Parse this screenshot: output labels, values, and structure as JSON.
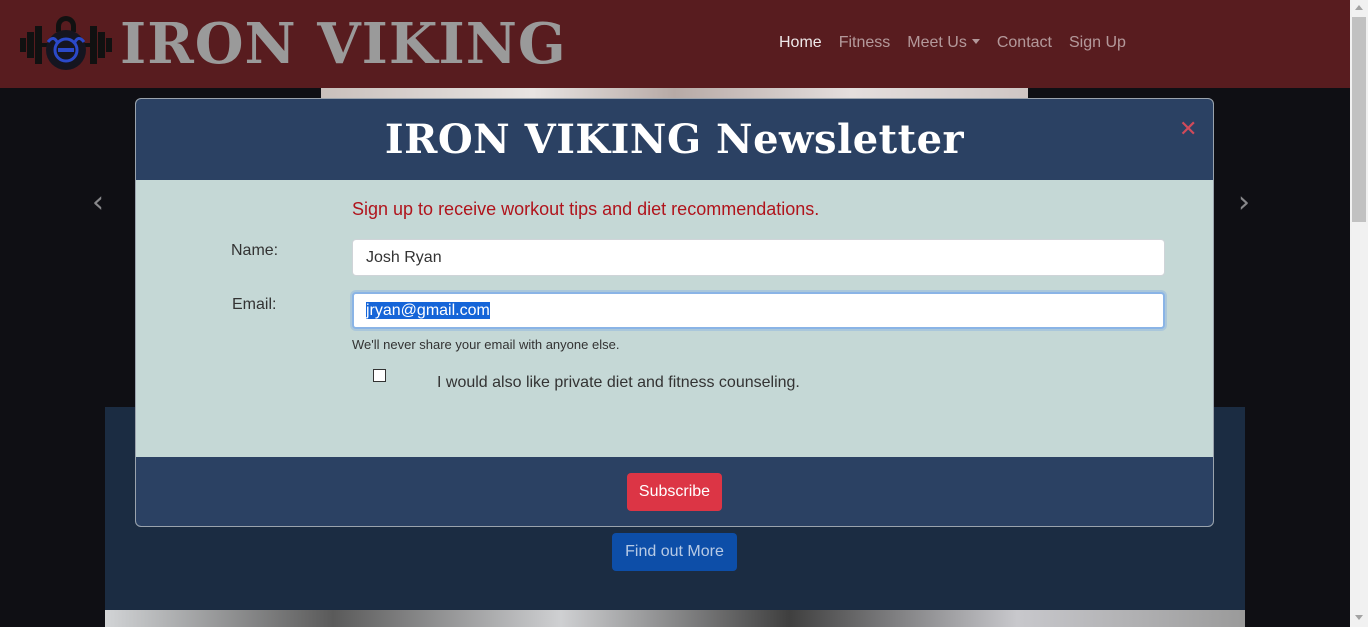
{
  "navbar": {
    "brand_text": "IRON VIKING",
    "links": [
      {
        "label": "Home",
        "active": true
      },
      {
        "label": "Fitness",
        "active": false
      },
      {
        "label": "Meet Us",
        "active": false,
        "dropdown": true
      },
      {
        "label": "Contact",
        "active": false
      },
      {
        "label": "Sign Up",
        "active": false
      }
    ]
  },
  "carousel": {
    "prev_icon": "chevron-left-icon",
    "next_icon": "chevron-right-icon"
  },
  "page": {
    "find_more_label": "Find out More"
  },
  "modal": {
    "title": "IRON VIKING Newsletter",
    "close_icon": "close-icon",
    "intro": "Sign up to receive workout tips and diet recommendations.",
    "name_label": "Name:",
    "name_value": "Josh Ryan",
    "email_label": "Email:",
    "email_value": "jryan@gmail.com",
    "email_help": "We'll never share your email with anyone else.",
    "checkbox_checked": false,
    "checkbox_label": "I would also like private diet and fitness counseling.",
    "subscribe_label": "Subscribe"
  },
  "colors": {
    "navbar_bg": "#581c1f",
    "modal_header_bg": "#2b4163",
    "modal_body_bg": "#c5d8d6",
    "intro_text": "#b0141c",
    "subscribe_bg": "#dc3545",
    "find_more_bg": "#0d4ea8"
  }
}
